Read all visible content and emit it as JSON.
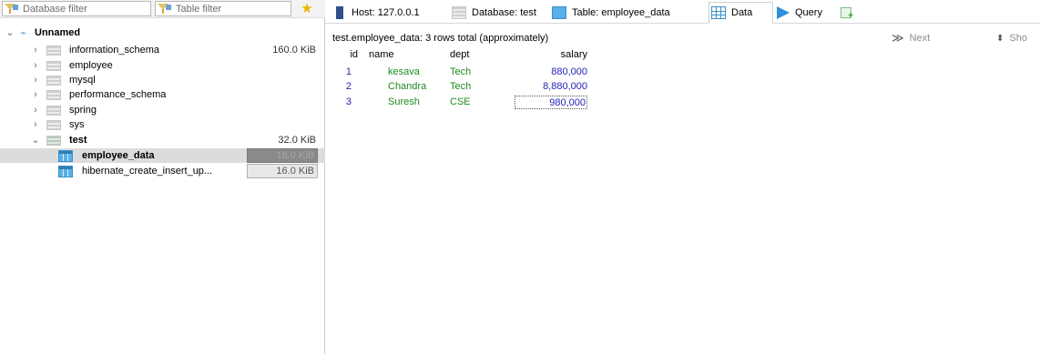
{
  "left_panel": {
    "database_filter_placeholder": "Database filter",
    "table_filter_placeholder": "Table filter",
    "tree": {
      "root_label": "Unnamed",
      "databases": [
        {
          "name": "information_schema",
          "size": "160.0 KiB"
        },
        {
          "name": "employee",
          "size": ""
        },
        {
          "name": "mysql",
          "size": ""
        },
        {
          "name": "performance_schema",
          "size": ""
        },
        {
          "name": "spring",
          "size": ""
        },
        {
          "name": "sys",
          "size": ""
        },
        {
          "name": "test",
          "size": "32.0 KiB"
        }
      ],
      "tables": [
        {
          "name": "employee_data",
          "size": "16.0 KiB"
        },
        {
          "name": "hibernate_create_insert_up...",
          "size": "16.0 KiB"
        }
      ]
    }
  },
  "tabs": [
    {
      "label": "Host: 127.0.0.1",
      "icon": "host-icon"
    },
    {
      "label": "Database: test",
      "icon": "database-icon"
    },
    {
      "label": "Table: employee_data",
      "icon": "table-icon"
    },
    {
      "label": "Data",
      "icon": "grid-icon",
      "active": true
    },
    {
      "label": "Query",
      "icon": "play-icon"
    },
    {
      "label": "",
      "icon": "new-query-tab-icon"
    }
  ],
  "data_view": {
    "info": "test.employee_data: 3 rows total (approximately)",
    "next_label": "Next",
    "show_label": "Sho",
    "columns": [
      "id",
      "name",
      "dept",
      "salary"
    ],
    "rows": [
      {
        "id": "1",
        "name": "kesava",
        "dept": "Tech",
        "salary": "880,000"
      },
      {
        "id": "2",
        "name": "Chandra",
        "dept": "Tech",
        "salary": "8,880,000"
      },
      {
        "id": "3",
        "name": "Suresh",
        "dept": "CSE",
        "salary": "980,000"
      }
    ]
  },
  "colors": {
    "text_value": "#1f8a1f",
    "number_value": "#2424b8",
    "star": "#f0b400",
    "table_icon": "#5ab0e6"
  }
}
